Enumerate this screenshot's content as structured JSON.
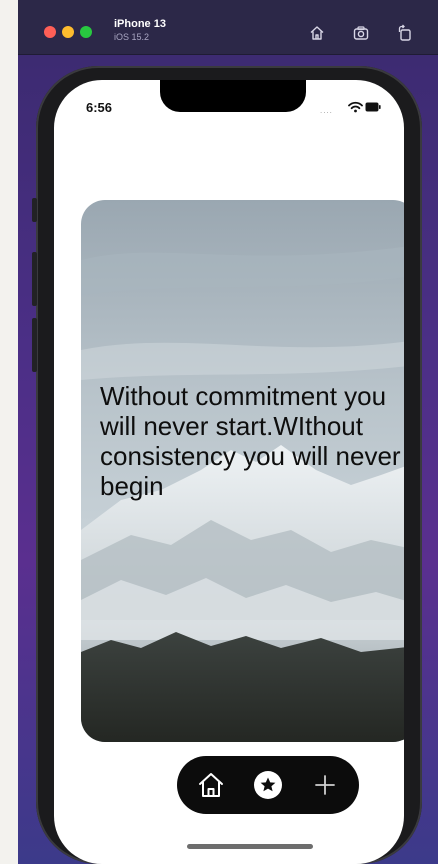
{
  "titlebar": {
    "device_name": "iPhone 13",
    "os_version": "iOS 15.2",
    "icons": [
      "home-icon",
      "screenshot-icon",
      "rotate-icon"
    ]
  },
  "status_bar": {
    "time": "6:56",
    "signal_text": "....",
    "icons": [
      "wifi-icon",
      "battery-icon"
    ]
  },
  "quote_card": {
    "text": "Without commitment you will never start.WIthout consistency you will never begin",
    "background": "snowy-mountain-photo"
  },
  "tab_bar": {
    "items": [
      {
        "icon": "home-icon",
        "label": "Home"
      },
      {
        "icon": "star-icon",
        "label": "Favorites"
      },
      {
        "icon": "plus-icon",
        "label": "Add"
      }
    ]
  },
  "colors": {
    "tab_bar": "#0c0c0c",
    "simulator_background": "#4b2f86"
  }
}
